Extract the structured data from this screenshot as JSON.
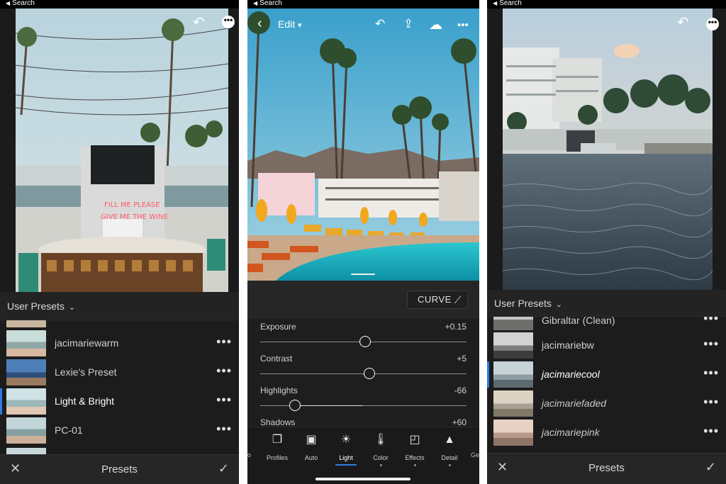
{
  "left": {
    "status": "Search",
    "presets_header": "User Presets",
    "presets": [
      {
        "name": "jacimariewarm",
        "more": "•••",
        "selected": false
      },
      {
        "name": "Lexie's Preset",
        "more": "•••",
        "selected": false
      },
      {
        "name": "Light & Bright",
        "more": "•••",
        "selected": true
      },
      {
        "name": "PC-01",
        "more": "•••",
        "selected": false
      }
    ],
    "bottom": {
      "cancel": "✕",
      "title": "Presets",
      "confirm": "✓"
    }
  },
  "middle": {
    "status": "Search",
    "toolbar": {
      "back": "‹",
      "edit_label": "Edit",
      "edit_chevron": "▾",
      "undo": "↶",
      "share": "⇪",
      "cloud": "☁",
      "more": "•••"
    },
    "curve_label": "CURVE",
    "sliders": [
      {
        "label": "Exposure",
        "value": "+0.15",
        "pos": 0.51
      },
      {
        "label": "Contrast",
        "value": "+5",
        "pos": 0.53
      },
      {
        "label": "Highlights",
        "value": "-66",
        "pos": 0.17
      },
      {
        "label": "Shadows",
        "value": "+60",
        "pos": 0.8
      }
    ],
    "tools": [
      {
        "label": "Profiles",
        "icon": "profiles-icon"
      },
      {
        "label": "Auto",
        "icon": "auto-icon"
      },
      {
        "label": "Light",
        "icon": "light-icon",
        "active": true
      },
      {
        "label": "Color",
        "icon": "color-icon"
      },
      {
        "label": "Effects",
        "icon": "effects-icon"
      },
      {
        "label": "Detail",
        "icon": "detail-icon"
      }
    ],
    "tools_edge_left": "o",
    "tools_edge_right": "Ge"
  },
  "right": {
    "status": "Search",
    "presets_header": "User Presets",
    "presets": [
      {
        "name": "Gibraltar (Clean)",
        "more": "•••",
        "selected": false,
        "italic": false
      },
      {
        "name": "jacimariebw",
        "more": "•••",
        "selected": false,
        "italic": false
      },
      {
        "name": "jacimariecool",
        "more": "•••",
        "selected": true,
        "italic": true
      },
      {
        "name": "jacimariefaded",
        "more": "•••",
        "selected": false,
        "italic": true
      },
      {
        "name": "jacimariepink",
        "more": "•••",
        "selected": false,
        "italic": true
      }
    ],
    "bottom": {
      "cancel": "✕",
      "title": "Presets",
      "confirm": "✓"
    }
  },
  "colors": {
    "accent": "#2d7be6",
    "panel_bg": "#1b1b1b"
  }
}
